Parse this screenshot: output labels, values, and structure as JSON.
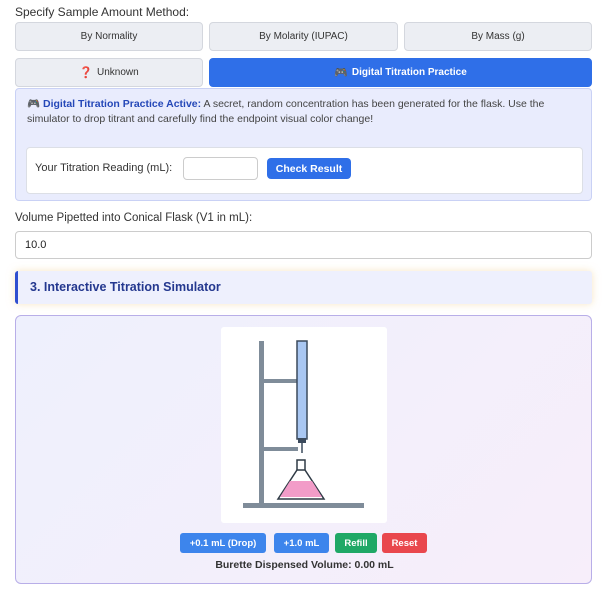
{
  "method": {
    "label": "Specify Sample Amount Method:",
    "options": [
      {
        "label": "By Normality",
        "icon": "",
        "active": false
      },
      {
        "label": "By Molarity (IUPAC)",
        "icon": "",
        "active": false
      },
      {
        "label": "By Mass (g)",
        "icon": "",
        "active": false
      },
      {
        "label": "Unknown",
        "icon": "❓",
        "active": false
      },
      {
        "label": "Digital Titration Practice",
        "icon": "🎮",
        "active": true
      }
    ]
  },
  "practice": {
    "icon": "🎮",
    "title": "Digital Titration Practice Active:",
    "message": " A secret, random concentration has been generated for the flask. Use the simulator to drop titrant and carefully find the endpoint visual color change!",
    "reading_label": "Your Titration Reading (mL):",
    "reading_value": "",
    "check_label": "Check Result"
  },
  "volume": {
    "label": "Volume Pipetted into Conical Flask (V1 in mL):",
    "value": "10.0"
  },
  "simulator": {
    "heading": "3. Interactive Titration Simulator",
    "buttons": {
      "drop": "+0.1 mL (Drop)",
      "one": "+1.0 mL",
      "refill": "Refill",
      "reset": "Reset"
    },
    "dispensed_label": "Burette Dispensed Volume: 0.00 mL",
    "colors": {
      "solution": "#f29cc8",
      "burette": "#a9c7f2",
      "stand": "#7f8c99"
    }
  }
}
